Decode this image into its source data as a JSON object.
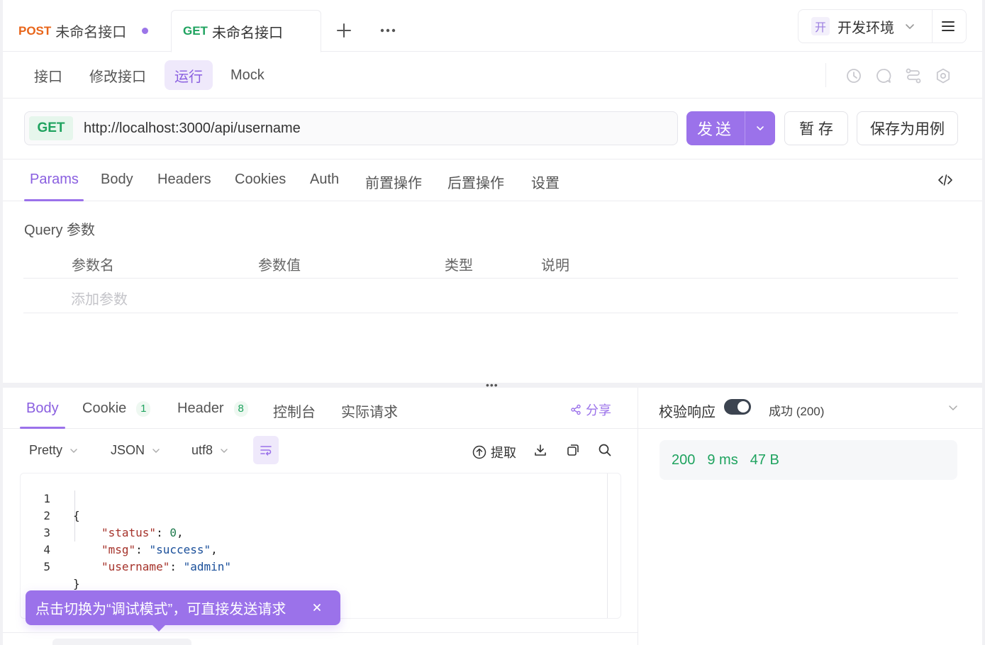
{
  "tabs": [
    {
      "method": "POST",
      "title": "未命名接口"
    },
    {
      "method": "GET",
      "title": "未命名接口"
    }
  ],
  "env": {
    "badge": "开",
    "name": "开发环境"
  },
  "subnav": {
    "items": [
      "接口",
      "修改接口",
      "运行",
      "Mock"
    ],
    "active": "运行"
  },
  "request": {
    "method": "GET",
    "url": "http://localhost:3000/api/username",
    "send_label": "发送",
    "stash_label": "暂 存",
    "save_case_label": "保存为用例"
  },
  "req_tabs": [
    "Params",
    "Body",
    "Headers",
    "Cookies",
    "Auth",
    "前置操作",
    "后置操作",
    "设置"
  ],
  "query": {
    "title": "Query 参数",
    "columns": [
      "参数名",
      "参数值",
      "类型",
      "说明"
    ],
    "add_placeholder": "添加参数"
  },
  "response": {
    "tabs": [
      {
        "label": "Body"
      },
      {
        "label": "Cookie",
        "badge": "1"
      },
      {
        "label": "Header",
        "badge": "8"
      },
      {
        "label": "控制台"
      },
      {
        "label": "实际请求"
      }
    ],
    "share_label": "分享",
    "format": {
      "view": "Pretty",
      "type": "JSON",
      "encoding": "utf8"
    },
    "extract_label": "提取",
    "code_lines": [
      {
        "n": "1",
        "text": "{"
      },
      {
        "n": "2",
        "key": "\"status\"",
        "value": "0",
        "suffix": ","
      },
      {
        "n": "3",
        "key": "\"msg\"",
        "value": "\"success\"",
        "suffix": ","
      },
      {
        "n": "4",
        "key": "\"username\"",
        "value": "\"admin\"",
        "suffix": ""
      },
      {
        "n": "5",
        "text": "}"
      }
    ],
    "hint": "点击切换为“调试模式”，可直接发送请求"
  },
  "verify": {
    "label": "校验响应",
    "status": "成功 (200)",
    "metrics": [
      "200",
      "9 ms",
      "47 B"
    ]
  },
  "colors": {
    "accent": "#9b72ea",
    "get": "#1fa35f",
    "post": "#e8651a"
  }
}
